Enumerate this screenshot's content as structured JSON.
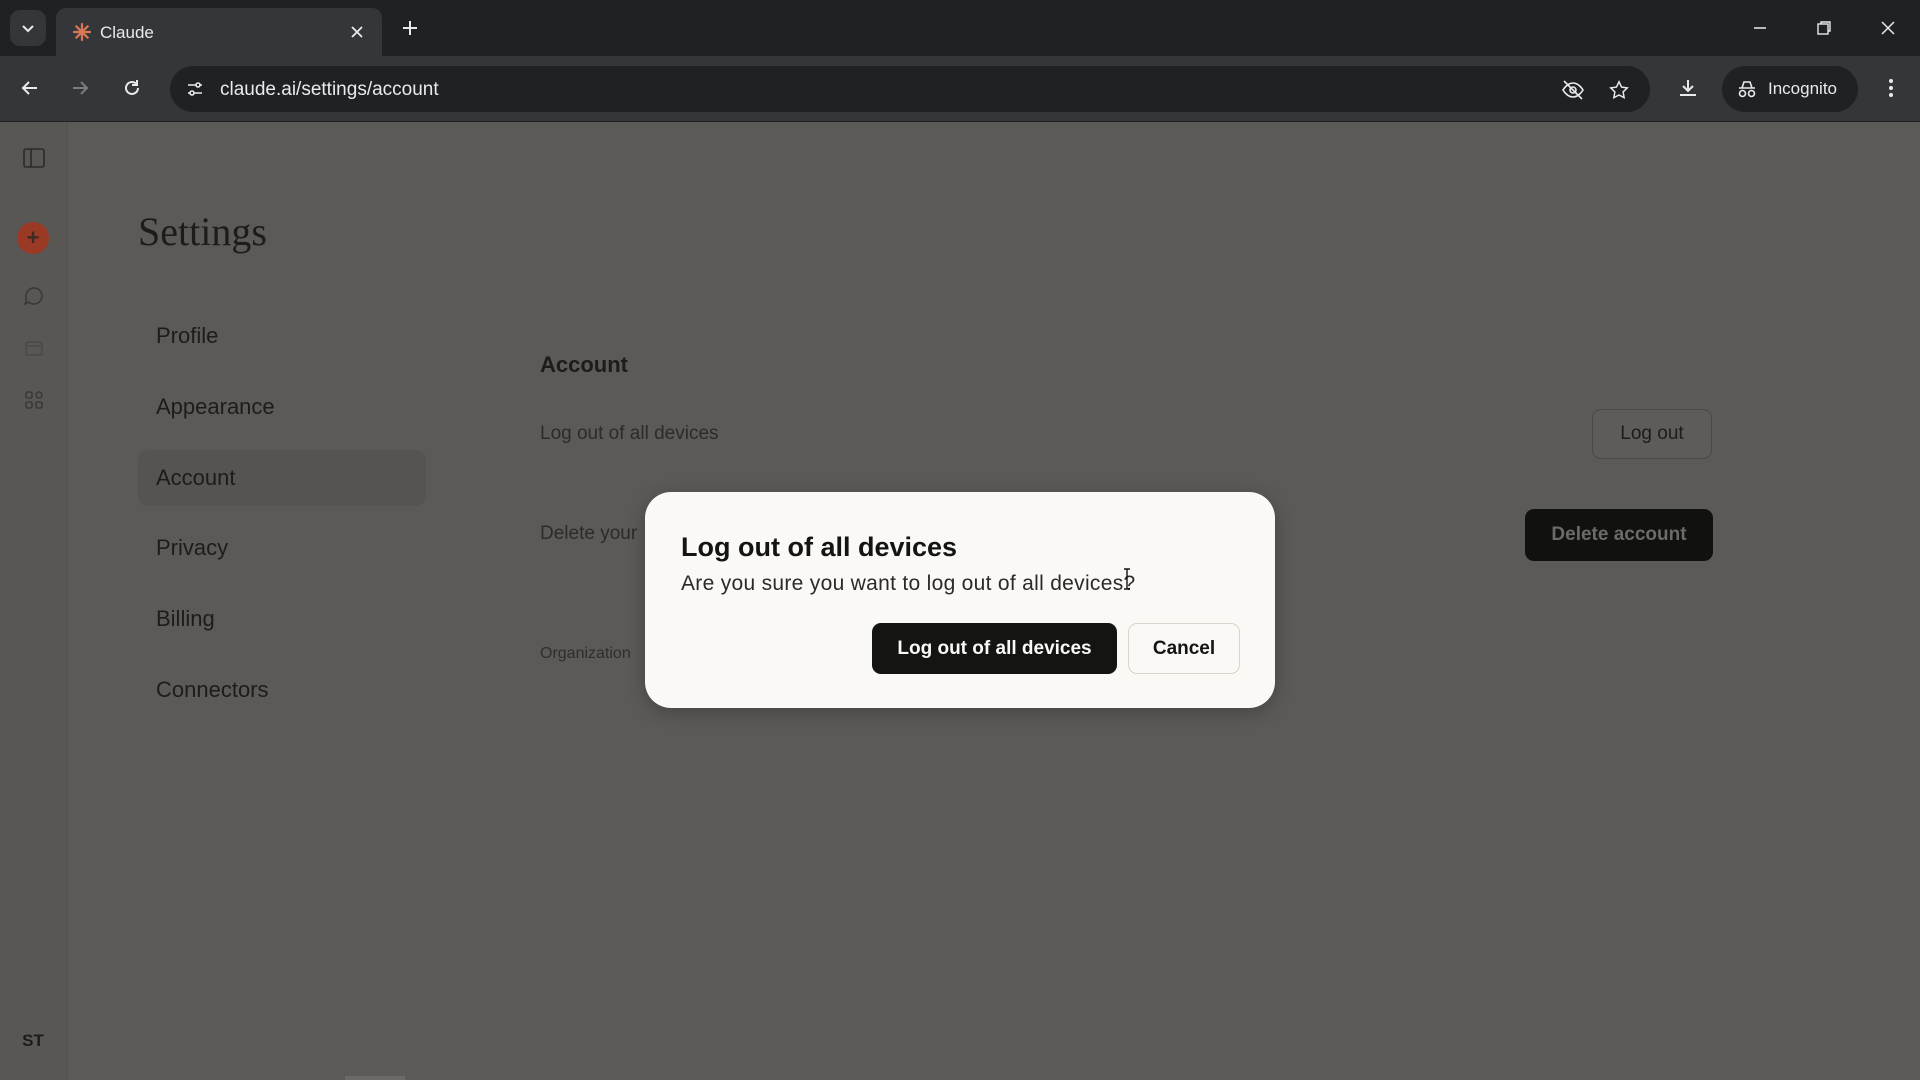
{
  "browser": {
    "tab_title": "Claude",
    "url": "claude.ai/settings/account",
    "incognito_label": "Incognito"
  },
  "settings": {
    "title": "Settings",
    "nav": [
      {
        "label": "Profile"
      },
      {
        "label": "Appearance"
      },
      {
        "label": "Account",
        "active": true
      },
      {
        "label": "Privacy"
      },
      {
        "label": "Billing"
      },
      {
        "label": "Connectors"
      }
    ]
  },
  "account": {
    "section_title": "Account",
    "logout_all_label": "Log out of all devices",
    "logout_button": "Log out",
    "delete_label": "Delete your",
    "delete_button": "Delete account",
    "organization_label": "Organization"
  },
  "modal": {
    "title": "Log out of all devices",
    "message": "Are you sure you want to log out of all devices?",
    "confirm_button": "Log out of all devices",
    "cancel_button": "Cancel"
  },
  "user": {
    "initials": "ST"
  },
  "colors": {
    "accent": "#d97757",
    "overlay_bg": "#5b5a57",
    "modal_bg": "#faf9f5"
  }
}
